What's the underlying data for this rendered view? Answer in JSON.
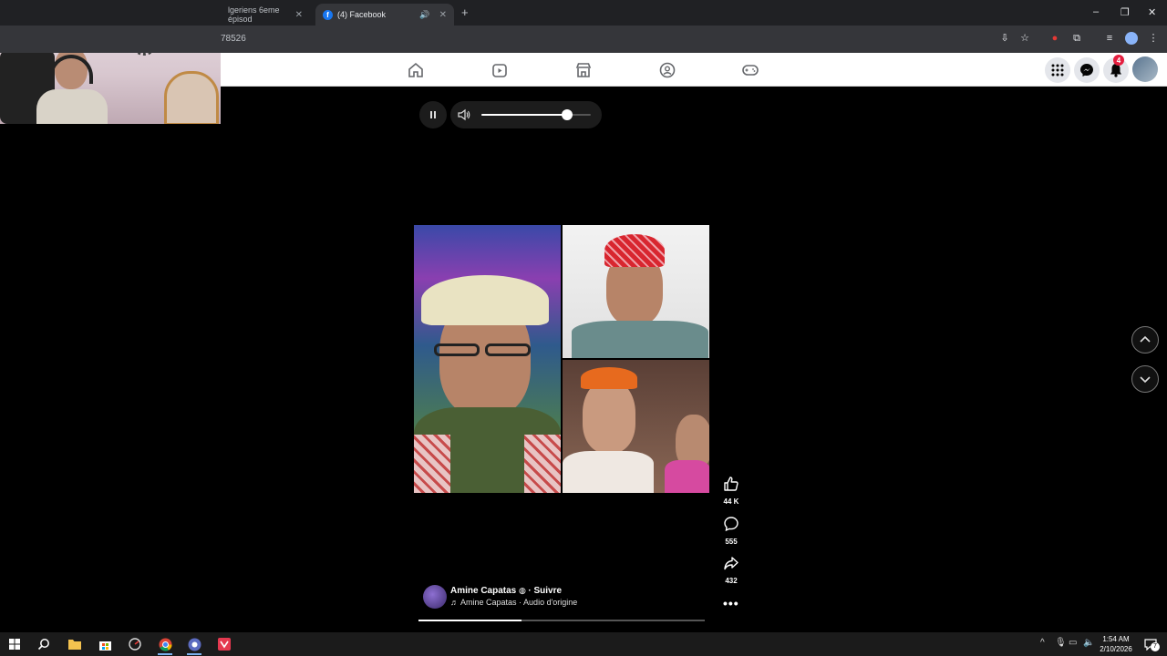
{
  "browser": {
    "tabs": [
      {
        "label": "lgeriens 6eme épisod",
        "active": false
      },
      {
        "label": "(4) Facebook",
        "active": true
      }
    ],
    "address": "78526",
    "new_tab": "+",
    "window_controls": [
      "–",
      "❐",
      "✕"
    ]
  },
  "facebook_nav": {
    "icons": [
      "home-icon",
      "video-icon",
      "marketplace-icon",
      "groups-icon",
      "gaming-icon"
    ],
    "right": [
      "menu-grid-icon",
      "messenger-icon",
      "notifications-icon",
      "account-avatar"
    ],
    "notification_count": "4"
  },
  "player": {
    "volume": 0.78,
    "progress": 0.36
  },
  "actions": {
    "likes": "44 K",
    "comments": "555",
    "shares": "432"
  },
  "author": {
    "name": "Amine Capatas",
    "follow": "· Suivre",
    "audio": "Amine Capatas · Audio d'origine"
  },
  "taskbar": {
    "time": "1:54 AM",
    "date": "2/10/2026",
    "notification_count": "7"
  },
  "colors": {
    "facebook_blue": "#1877f2",
    "badge_red": "#e41e3f"
  }
}
